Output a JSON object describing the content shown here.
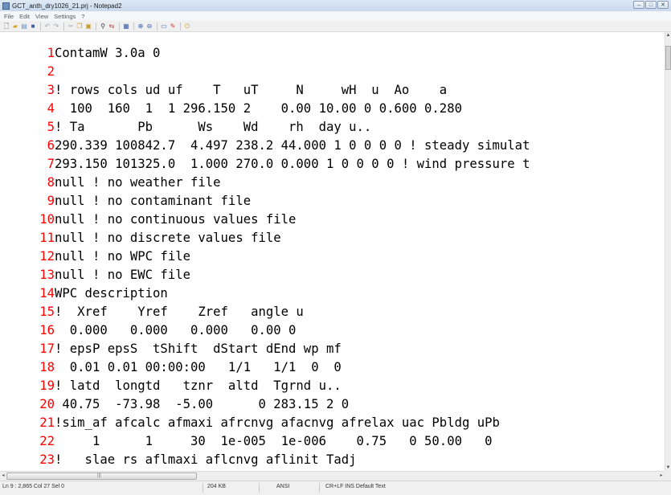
{
  "window": {
    "title": "GCT_anth_dry1026_21.prj - Notepad2"
  },
  "window_buttons": {
    "minimize": "–",
    "maximize": "□",
    "close": "✕"
  },
  "menu": [
    "File",
    "Edit",
    "View",
    "Settings",
    "?"
  ],
  "toolbar": {
    "icons": [
      {
        "name": "new-file-icon",
        "glyph": "🗋",
        "color": "#555555"
      },
      {
        "name": "open-folder-icon",
        "glyph": "▰",
        "color": "#d9a528"
      },
      {
        "name": "browse-icon",
        "glyph": "▤",
        "color": "#6b8fc5"
      },
      {
        "name": "save-icon",
        "glyph": "■",
        "color": "#3c5fa8"
      },
      {
        "sep": true
      },
      {
        "name": "undo-icon",
        "glyph": "↶",
        "color": "#9aa8bd"
      },
      {
        "name": "redo-icon",
        "glyph": "↷",
        "color": "#9aa8bd"
      },
      {
        "sep": true
      },
      {
        "name": "cut-icon",
        "glyph": "✂",
        "color": "#9aa8bd"
      },
      {
        "name": "copy-icon",
        "glyph": "❐",
        "color": "#c99a2c"
      },
      {
        "name": "paste-icon",
        "glyph": "▣",
        "color": "#c99a2c"
      },
      {
        "sep": true
      },
      {
        "name": "find-icon",
        "glyph": "⚲",
        "color": "#333333"
      },
      {
        "name": "replace-icon",
        "glyph": "⇆",
        "color": "#c23a3a"
      },
      {
        "sep": true
      },
      {
        "name": "go-to-icon",
        "glyph": "▦",
        "color": "#3c5fa8"
      },
      {
        "sep": true
      },
      {
        "name": "zoom-in-icon",
        "glyph": "⊕",
        "color": "#3c5fa8"
      },
      {
        "name": "zoom-out-icon",
        "glyph": "⊖",
        "color": "#3c5fa8"
      },
      {
        "sep": true
      },
      {
        "name": "word-wrap-icon",
        "glyph": "▭",
        "color": "#3c5fa8"
      },
      {
        "name": "scheme-icon",
        "glyph": "✎",
        "color": "#c23a3a"
      },
      {
        "sep": true
      },
      {
        "name": "exit-icon",
        "glyph": "⏻",
        "color": "#c99a2c"
      }
    ]
  },
  "editor": {
    "lines": [
      {
        "num": "1",
        "text": "ContamW 3.0a 0"
      },
      {
        "num": "2",
        "text": ""
      },
      {
        "num": "3",
        "text": "! rows cols ud uf    T   uT     N     wH  u  Ao    a"
      },
      {
        "num": "4",
        "text": "  100  160  1  1 296.150 2    0.00 10.00 0 0.600 0.280"
      },
      {
        "num": "5",
        "text": "! Ta       Pb      Ws    Wd    rh  day u.."
      },
      {
        "num": "6",
        "text": "290.339 100842.7  4.497 238.2 44.000 1 0 0 0 0 ! steady simulat"
      },
      {
        "num": "7",
        "text": "293.150 101325.0  1.000 270.0 0.000 1 0 0 0 0 ! wind pressure t"
      },
      {
        "num": "8",
        "text": "null ! no weather file"
      },
      {
        "num": "9",
        "text": "null ! no contaminant file"
      },
      {
        "num": "10",
        "text": "null ! no continuous values file"
      },
      {
        "num": "11",
        "text": "null ! no discrete values file"
      },
      {
        "num": "12",
        "text": "null ! no WPC file"
      },
      {
        "num": "13",
        "text": "null ! no EWC file"
      },
      {
        "num": "14",
        "text": "WPC description"
      },
      {
        "num": "15",
        "text": "!  Xref    Yref    Zref   angle u"
      },
      {
        "num": "16",
        "text": "  0.000   0.000   0.000   0.00 0"
      },
      {
        "num": "17",
        "text": "! epsP epsS  tShift  dStart dEnd wp mf"
      },
      {
        "num": "18",
        "text": "  0.01 0.01 00:00:00   1/1   1/1  0  0"
      },
      {
        "num": "19",
        "text": "! latd  longtd   tznr  altd  Tgrnd u.."
      },
      {
        "num": "20",
        "text": " 40.75  -73.98  -5.00      0 283.15 2 0"
      },
      {
        "num": "21",
        "text": "!sim_af afcalc afmaxi afrcnvg afacnvg afrelax uac Pbldg uPb"
      },
      {
        "num": "22",
        "text": "     1      1     30  1e-005  1e-006    0.75   0 50.00   0"
      },
      {
        "num": "23",
        "text": "!   slae rs aflmaxi aflcnvg aflinit Tadj"
      }
    ]
  },
  "statusbar": {
    "position": "Ln 9 : 2,865  Col 27  Sel 0",
    "size": "204 KB",
    "encoding": "ANSI",
    "eol_mode": "CR+LF  INS  Default Text"
  }
}
